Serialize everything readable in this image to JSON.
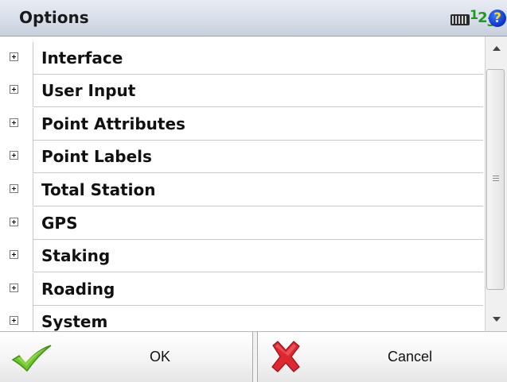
{
  "window": {
    "title": "Options"
  },
  "header_icons": {
    "keyboard": "keyboard-icon",
    "numeric": {
      "d1": "1",
      "d2": "2",
      "d3": "3",
      "color": "#1e9a1e"
    },
    "help": "?"
  },
  "list": {
    "items": [
      {
        "label": "Interface",
        "expander": "+"
      },
      {
        "label": "User Input",
        "expander": "+"
      },
      {
        "label": "Point Attributes",
        "expander": "+"
      },
      {
        "label": "Point Labels",
        "expander": "+"
      },
      {
        "label": "Total Station",
        "expander": "+"
      },
      {
        "label": "GPS",
        "expander": "+"
      },
      {
        "label": "Staking",
        "expander": "+"
      },
      {
        "label": "Roading",
        "expander": "+"
      },
      {
        "label": "System",
        "expander": "+"
      }
    ]
  },
  "buttons": {
    "ok_label": "OK",
    "cancel_label": "Cancel"
  },
  "colors": {
    "check": "#5bb81e",
    "cross": "#d8232a",
    "help_bg": "#0b2fc7",
    "help_fg": "#ffe000"
  }
}
